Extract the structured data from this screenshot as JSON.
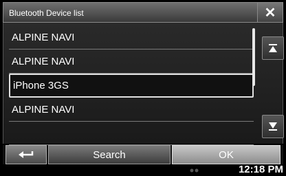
{
  "window": {
    "title": "Bluetooth Device list",
    "close_glyph": "✕"
  },
  "devices": [
    {
      "label": "ALPINE NAVI",
      "selected": false
    },
    {
      "label": "ALPINE NAVI",
      "selected": false
    },
    {
      "label": "iPhone 3GS",
      "selected": true
    },
    {
      "label": "ALPINE NAVI",
      "selected": false
    }
  ],
  "scroll": {
    "up_icon": "scroll-to-top-icon",
    "down_icon": "scroll-to-bottom-icon"
  },
  "bottom": {
    "back_icon": "back-arrow-icon",
    "search_label": "Search",
    "ok_label": "OK"
  },
  "status": {
    "time": "12:18 PM",
    "icon": "phone-status-icon"
  },
  "colors": {
    "selected_border": "#e0e0e0",
    "ok_button": "#b4b4b4"
  }
}
